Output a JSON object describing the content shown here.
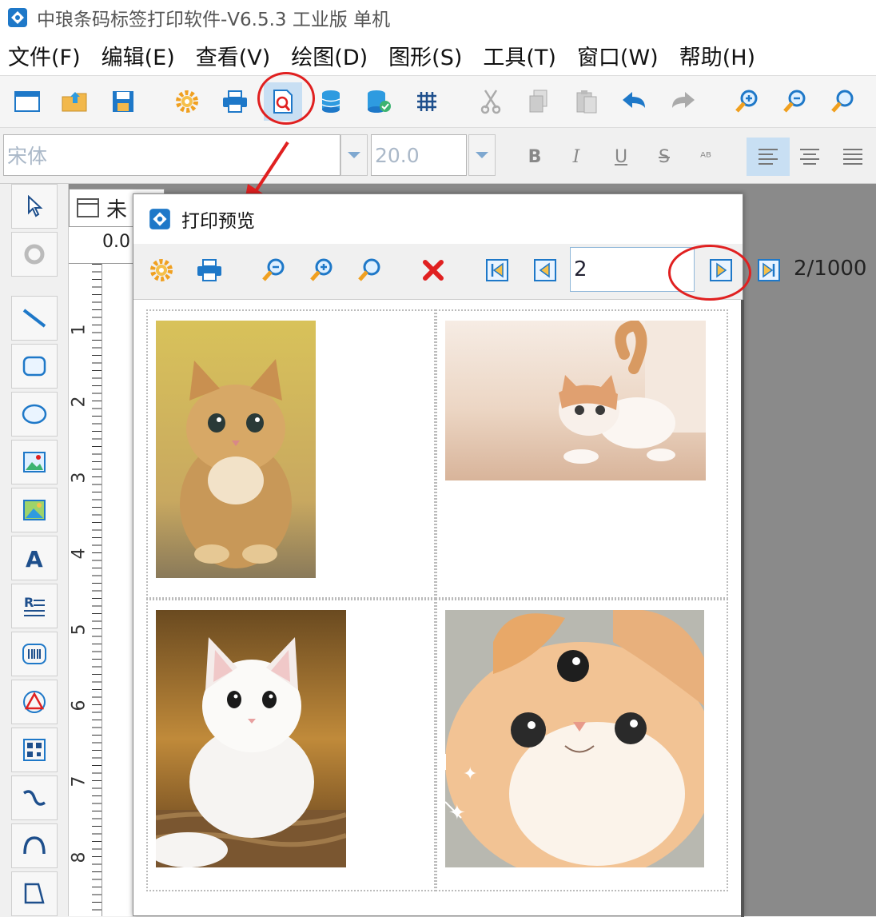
{
  "app": {
    "title": "中琅条码标签打印软件-V6.5.3 工业版 单机"
  },
  "menu": [
    "文件(F)",
    "编辑(E)",
    "查看(V)",
    "绘图(D)",
    "图形(S)",
    "工具(T)",
    "窗口(W)",
    "帮助(H)"
  ],
  "toolbar": {
    "icons": [
      "new-document-icon",
      "open-folder-icon",
      "save-icon",
      "settings-gear-icon",
      "print-icon",
      "print-preview-icon",
      "database-icon",
      "database-settings-icon",
      "grid-icon",
      "cut-icon",
      "copy-icon",
      "paste-icon",
      "undo-icon",
      "redo-icon",
      "zoom-in-icon",
      "zoom-out-icon",
      "zoom-fit-icon"
    ],
    "active": "print-preview-icon"
  },
  "font": {
    "name": "宋体",
    "size": "20.0",
    "format_buttons": [
      "B",
      "I",
      "U",
      "S",
      "ᴬᴮ"
    ]
  },
  "document_tab": {
    "title": "未"
  },
  "ruler": {
    "top_label": "0.0",
    "vertical_marks": [
      "1",
      "2",
      "3",
      "4",
      "5",
      "6",
      "7",
      "8"
    ]
  },
  "dialog": {
    "title": "打印预览",
    "current_page": "2",
    "page_count": "2/1000",
    "buttons": [
      "settings-icon",
      "print-icon",
      "zoom-out-icon",
      "zoom-in-icon",
      "zoom-fit-icon",
      "close-icon",
      "first-page-icon",
      "prev-page-icon",
      "next-page-icon",
      "last-page-icon"
    ]
  },
  "preview": {
    "labels": [
      {
        "photo": "orange-tabby-kitten-sitting"
      },
      {
        "photo": "white-orange-kitten-crouching"
      },
      {
        "photo": "white-fluffy-kitten-on-basket"
      },
      {
        "photo": "orange-white-cat-closeup"
      }
    ]
  },
  "colors": {
    "accent": "#1e78c8",
    "highlight": "#e02020",
    "active_button": "#c8dff3"
  }
}
